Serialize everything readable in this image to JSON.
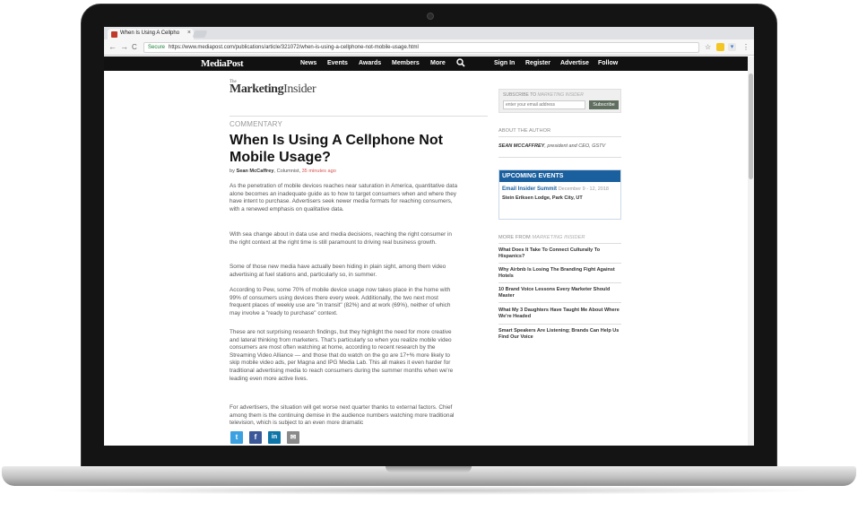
{
  "browser": {
    "tab_title": "When Is Using A Cellpho",
    "tab_close": "×",
    "back": "←",
    "forward": "→",
    "reload": "C",
    "secure_label": "Secure",
    "url": "https://www.mediapost.com/publications/article/321072/when-is-using-a-cellphone-not-mobile-usage.html",
    "star": "☆"
  },
  "sitenav": {
    "logo": "MediaPost",
    "links": [
      "News",
      "Events",
      "Awards",
      "Members",
      "More"
    ],
    "search_icon": "search-icon",
    "right_links": [
      "Sign In",
      "Register",
      "Advertise",
      "Follow"
    ]
  },
  "brand": {
    "the": "The",
    "name_bold": "Marketing",
    "name_rest": "Insider"
  },
  "article": {
    "kicker": "COMMENTARY",
    "headline": "When Is Using A Cellphone Not Mobile Usage?",
    "by": "by",
    "author": "Sean McCaffrey",
    "section": ", Columnist,",
    "time": "35 minutes ago",
    "paragraphs": [
      "As the penetration of mobile devices reaches near saturation in America, quantitative data alone becomes an inadequate guide as to how to target consumers when and where they have intent to purchase. Advertisers seek newer media formats for reaching consumers, with a renewed emphasis on qualitative data.",
      "With sea change about in data use and media decisions, reaching the right consumer in the right context at the right time is still paramount to driving real business growth.",
      "Some of those new media have actually been hiding in plain sight, among them video advertising at fuel stations and, particularly so, in summer.",
      "According to Pew, some 70% of mobile device usage now takes place in the home with 99% of consumers using devices there every week. Additionally, the two next most frequent places of weekly use are \"in transit\" (82%) and at work (69%), neither of which may involve a \"ready to purchase\" context.",
      "These are not surprising research findings, but they highlight the need for more creative and lateral thinking from marketers. That's particularly so when you realize mobile video consumers are most often watching at home, according to recent research by the Streaming Video Alliance — and those that do watch on the go are 17+% more likely to skip mobile video ads, per Magna and IPG Media Lab. This all makes it even harder for traditional advertising media to reach consumers during the summer months when we're leading even more active lives.",
      "For advertisers, the situation will get worse next quarter thanks to external factors. Chief among them is the continuing demise in the audience numbers watching more traditional television, which is subject to an even more dramatic"
    ]
  },
  "share": [
    "t",
    "f",
    "in",
    "✉"
  ],
  "sidebar": {
    "subscribe_label": "SUBSCRIBE TO",
    "subscribe_label_pub": "MARKETING INSIDER",
    "subscribe_placeholder": "enter your email address",
    "subscribe_button": "Subscribe",
    "about_heading": "ABOUT THE AUTHOR",
    "about_name": "SEAN MCCAFFREY",
    "about_title": ", president and CEO, GSTV",
    "events_heading": "UPCOMING EVENTS",
    "event_title": "Email Insider Summit",
    "event_date": "December 9 - 12, 2018",
    "event_location": "Stein Eriksen Lodge, Park City, UT",
    "more_heading": "MORE FROM",
    "more_heading_pub": "MARKETING INSIDER",
    "more_items": [
      "What Does It Take To Connect Culturally To Hispanics?",
      "Why Airbnb Is Losing The Branding Fight Against Hotels",
      "10 Brand Voice Lessons Every Marketer Should Master",
      "What My 3 Daughters Have Taught Me About Where We're Headed",
      "Smart Speakers Are Listening; Brands Can Help Us Find Our Voice"
    ]
  }
}
